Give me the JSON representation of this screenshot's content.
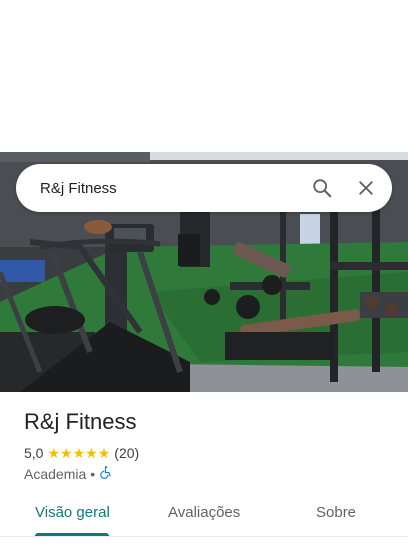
{
  "search": {
    "query": "R&j Fitness",
    "search_icon": "search-icon",
    "close_icon": "close-icon"
  },
  "photo": {
    "subject": "gym-interior-photo"
  },
  "place": {
    "name": "R&j Fitness",
    "rating": "5,0",
    "stars": 5,
    "reviews_count": "(20)",
    "category": "Academia",
    "separator": "•",
    "accessibility_icon": "wheelchair-icon"
  },
  "colors": {
    "accent": "#0b7a7c",
    "star": "#fbbc04",
    "accessibility": "#1a73e8"
  },
  "tabs": [
    {
      "label": "Visão geral",
      "active": true
    },
    {
      "label": "Avaliações",
      "active": false
    },
    {
      "label": "Sobre",
      "active": false
    }
  ]
}
